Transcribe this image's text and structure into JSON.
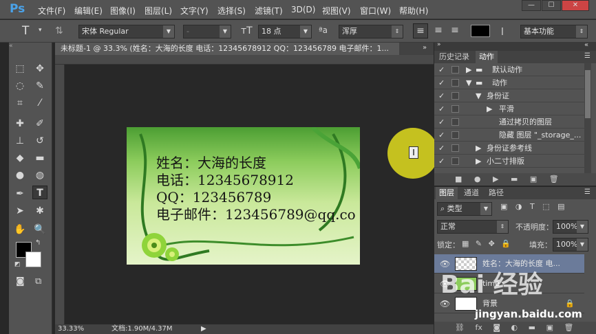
{
  "app": {
    "logo": "Ps"
  },
  "menu": [
    "文件(F)",
    "编辑(E)",
    "图像(I)",
    "图层(L)",
    "文字(Y)",
    "选择(S)",
    "滤镜(T)",
    "3D(D)",
    "视图(V)",
    "窗口(W)",
    "帮助(H)"
  ],
  "window_buttons": [
    "—",
    "☐",
    "✕"
  ],
  "options": {
    "font_family": "宋体 Regular",
    "font_style": "-",
    "font_size": "18 点",
    "antialias": "浑厚",
    "workspace": "基本功能"
  },
  "document": {
    "tab_title": "未标题-1 @ 33.3% (姓名：大海的长度 电话：12345678912 QQ：123456789 电子邮件：1...",
    "zoom": "33.33%",
    "doc_size": "文档:1.90M/4.37M"
  },
  "card": {
    "lines": [
      "姓名：大海的长度",
      "电话：12345678912",
      "QQ：123456789",
      "电子邮件：123456789@qq.co"
    ]
  },
  "history_panel": {
    "tabs": [
      "历史记录",
      "动作"
    ],
    "rows": [
      {
        "checked": true,
        "indent": 0,
        "label": "默认动作",
        "folder": true
      },
      {
        "checked": true,
        "indent": 0,
        "label": "动作",
        "folder": true
      },
      {
        "checked": true,
        "indent": 1,
        "label": "身份证"
      },
      {
        "checked": true,
        "indent": 2,
        "label": "平滑"
      },
      {
        "checked": true,
        "indent": 3,
        "label": "通过拷贝的图层"
      },
      {
        "checked": true,
        "indent": 3,
        "label": "隐藏 图层 \"_storage_..."
      },
      {
        "checked": true,
        "indent": 1,
        "label": "身份证参考线"
      },
      {
        "checked": true,
        "indent": 1,
        "label": "小二寸排版"
      }
    ]
  },
  "layers_panel": {
    "tabs": [
      "图层",
      "通道",
      "路径"
    ],
    "filter": "类型",
    "blend_mode": "正常",
    "opacity_label": "不透明度：",
    "opacity": "100%",
    "lock_label": "锁定：",
    "fill_label": "填充：",
    "fill": "100%",
    "layers": [
      {
        "name": "姓名：大海的长度 电...",
        "selected": true
      },
      {
        "name": "time"
      },
      {
        "name": "背景"
      }
    ]
  },
  "watermark": {
    "text": "Bai 经验",
    "sub": "jingyan.baidu.com"
  }
}
